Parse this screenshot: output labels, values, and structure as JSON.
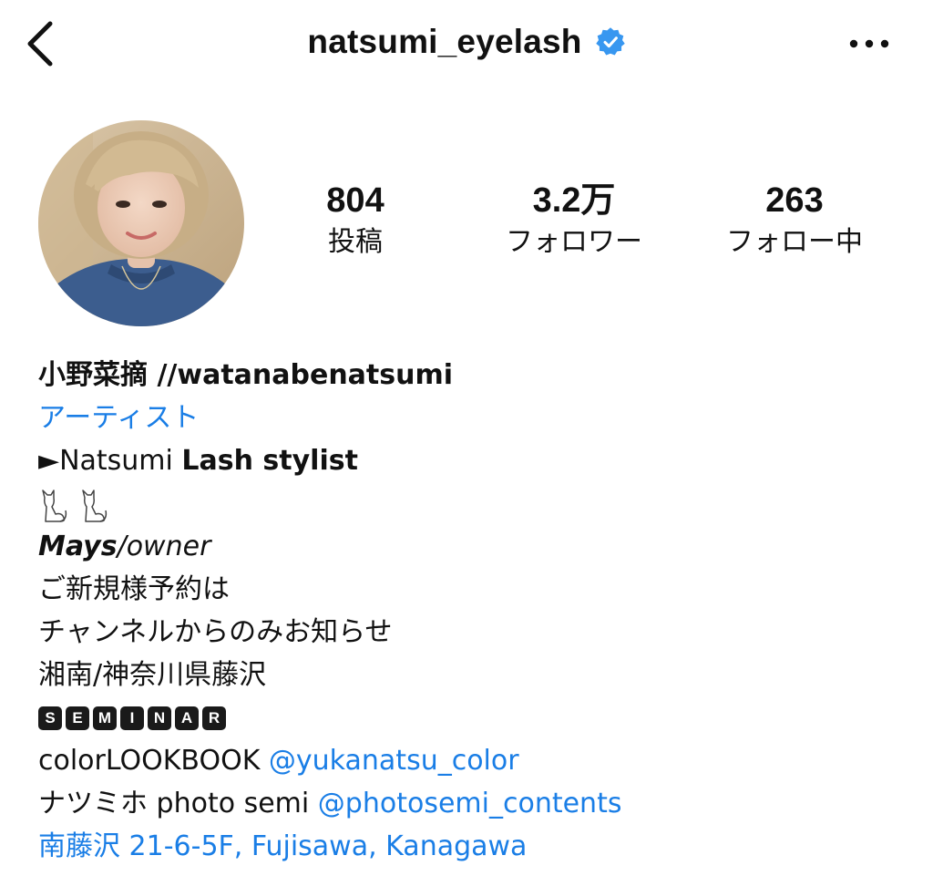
{
  "header": {
    "username": "natsumi_eyelash",
    "verified_icon": "verified-badge-icon",
    "back_icon": "chevron-left-icon",
    "more_icon": "ellipsis-icon"
  },
  "stats": {
    "posts": {
      "value": "804",
      "label": "投稿"
    },
    "followers": {
      "value": "3.2万",
      "label": "フォロワー"
    },
    "following": {
      "value": "263",
      "label": "フォロー中"
    }
  },
  "bio": {
    "name_jp": "小野菜摘",
    "name_sep": " //",
    "name_en": "watanabenatsumi",
    "category": "アーティスト",
    "stylist_prefix": "►Natsumi ",
    "stylist_bold": "Lash stylist",
    "mays_bold": "Mays",
    "mays_rest": "/owner",
    "line_reservation": "ご新規様予約は",
    "line_channel": "チャンネルからのみお知らせ",
    "line_location": "湘南/神奈川県藤沢",
    "seminar_letters": [
      "S",
      "E",
      "M",
      "I",
      "N",
      "A",
      "R"
    ],
    "lookbook_text": "colorLOOKBOOK ",
    "lookbook_link": "@yukanatsu_color",
    "photo_text": "ナツミホ photo semi ",
    "photo_link": "@photosemi_contents",
    "address": "南藤沢 21-6-5F, Fujisawa, Kanagawa"
  },
  "colors": {
    "accent_blue": "#1a7ee6",
    "verified_blue": "#3897f0",
    "text": "#111111"
  }
}
